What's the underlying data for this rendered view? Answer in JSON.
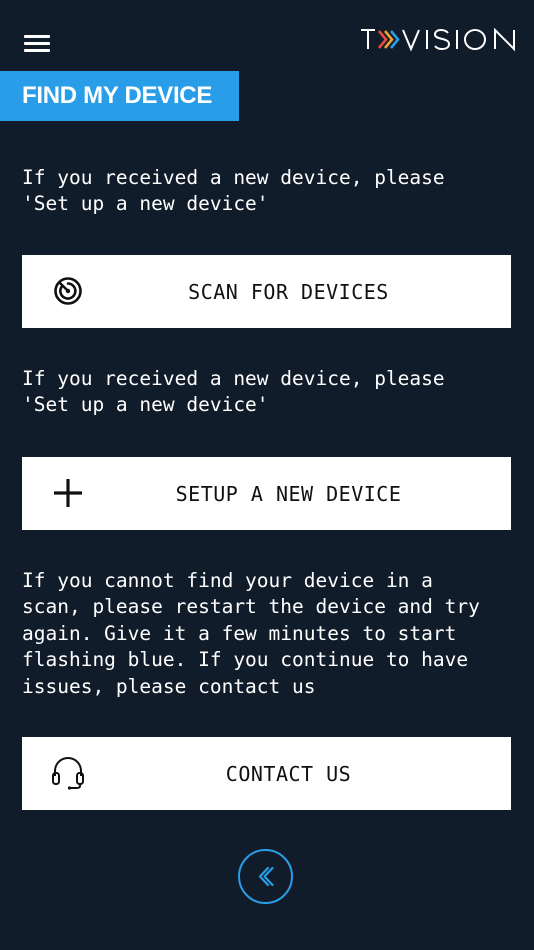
{
  "header": {
    "menu_icon": "hamburger-menu-icon",
    "logo_text": "T VISION",
    "logo_colors": [
      "#e84a3a",
      "#f0a030",
      "#2a9de8"
    ]
  },
  "page": {
    "title": "FIND MY DEVICE",
    "accent_color": "#2a9de8",
    "background_color": "#111c2a"
  },
  "sections": {
    "scan_info": "If you received a new device, please\n'Set up a new device'",
    "scan_button": {
      "label": "SCAN FOR DEVICES",
      "icon": "radar-scan-icon"
    },
    "setup_info": "If you received a new device, please\n'Set up a new device'",
    "setup_button": {
      "label": "SETUP A NEW DEVICE",
      "icon": "plus-icon"
    },
    "contact_info": "If you cannot find your device in a\nscan, please restart the device and try\nagain. Give it a few minutes to start\nflashing blue. If you continue to have\nissues, please contact us",
    "contact_button": {
      "label": "CONTACT US",
      "icon": "headset-icon"
    }
  },
  "footer": {
    "back_icon": "chevron-left-icon"
  }
}
